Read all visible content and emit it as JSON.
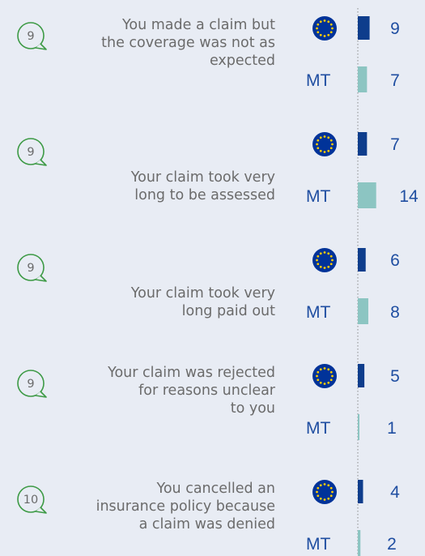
{
  "chart_data": {
    "type": "bar",
    "series": [
      {
        "name": "EU",
        "values": [
          9,
          7,
          6,
          5,
          4
        ]
      },
      {
        "name": "MT",
        "values": [
          7,
          14,
          8,
          1,
          2
        ]
      }
    ],
    "categories": [
      {
        "number": "9",
        "lines": [
          "You made a claim but",
          "the coverage was not as",
          "expected"
        ]
      },
      {
        "number": "9",
        "lines": [
          "Your claim took very",
          "long to be assessed"
        ]
      },
      {
        "number": "9",
        "lines": [
          "Your claim took very",
          "long paid out"
        ]
      },
      {
        "number": "9",
        "lines": [
          "Your claim was rejected",
          "for reasons unclear",
          "to you"
        ]
      },
      {
        "number": "10",
        "lines": [
          "You cancelled an",
          "insurance policy because",
          "a claim was denied"
        ]
      }
    ],
    "colors": {
      "eu_bar": "#0e3d8c",
      "mt_bar": "#8cc5c2",
      "text": "#6b6b6b",
      "value": "#1f4ea1",
      "eu_flag": "#003399",
      "eu_star": "#ffcc00"
    },
    "icons": {
      "question_marker": "speech-bubble-icon",
      "eu_marker": "eu-flag-icon"
    }
  }
}
